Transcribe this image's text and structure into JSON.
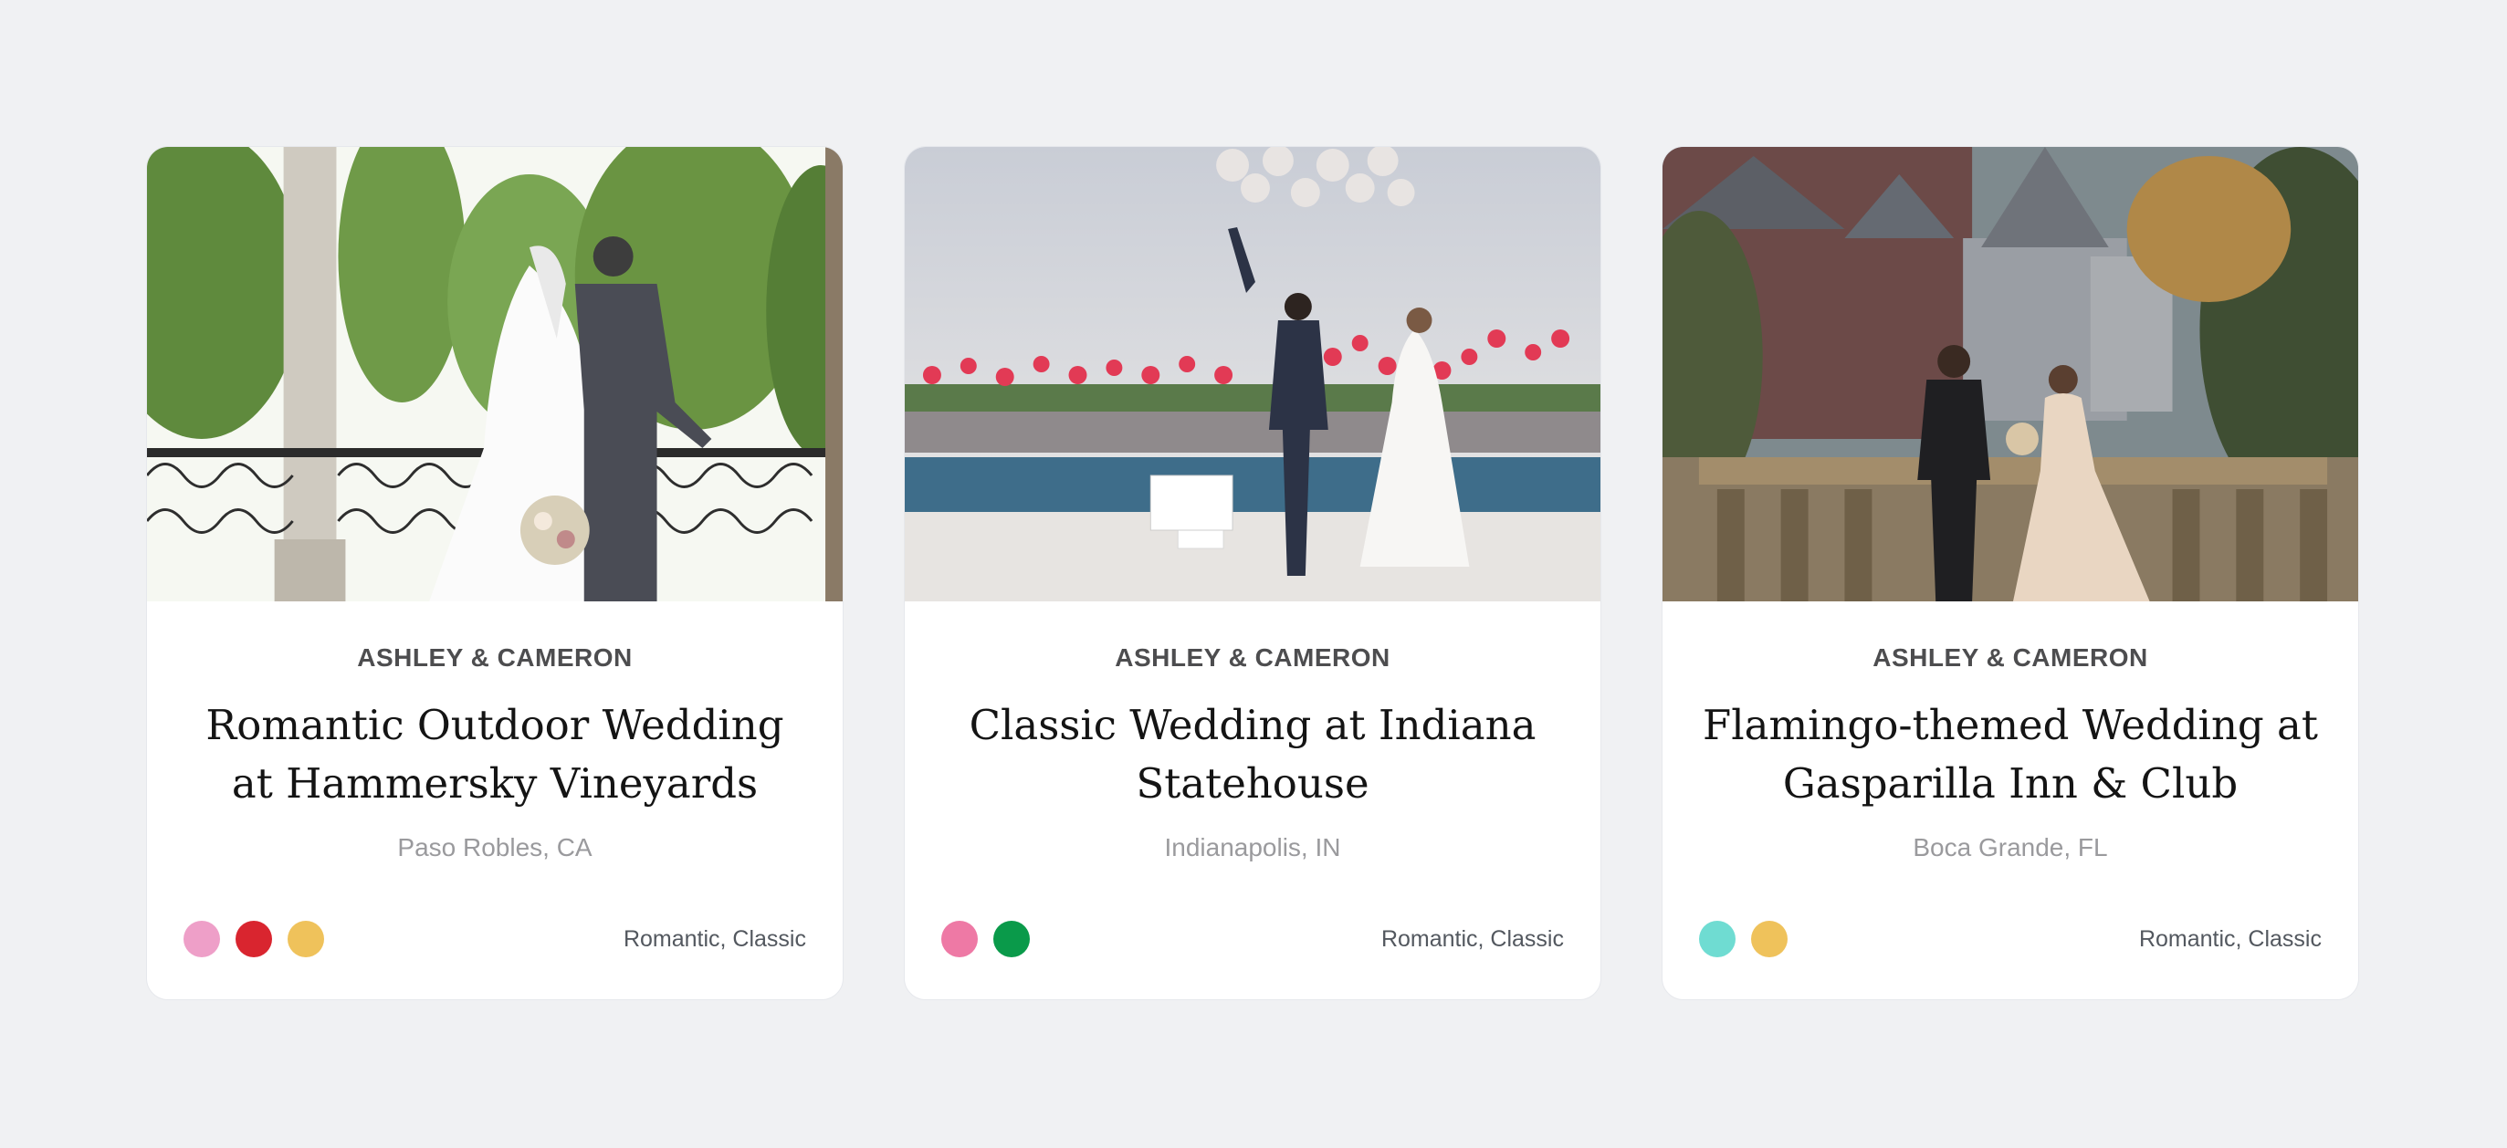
{
  "cards": [
    {
      "couple": "ASHLEY & CAMERON",
      "title": "Romantic Outdoor Wedding at Hammersky Vineyards",
      "location": "Paso Robles, CA",
      "colors": [
        "#ee9fc8",
        "#d9252f",
        "#efc25b"
      ],
      "tags": "Romantic, Classic",
      "photo_icon": "balcony-wedding-photo"
    },
    {
      "couple": "ASHLEY & CAMERON",
      "title": "Classic Wedding at Indiana Statehouse",
      "location": "Indianapolis, IN",
      "colors": [
        "#ee79a5",
        "#0a9a4a"
      ],
      "tags": "Romantic, Classic",
      "photo_icon": "poolside-balloons-photo"
    },
    {
      "couple": "ASHLEY & CAMERON",
      "title": "Flamingo-themed Wedding at Gasparilla Inn & Club",
      "location": "Boca Grande, FL",
      "colors": [
        "#6fdcd2",
        "#efc25b"
      ],
      "tags": "Romantic, Classic",
      "photo_icon": "castle-terrace-photo"
    }
  ]
}
